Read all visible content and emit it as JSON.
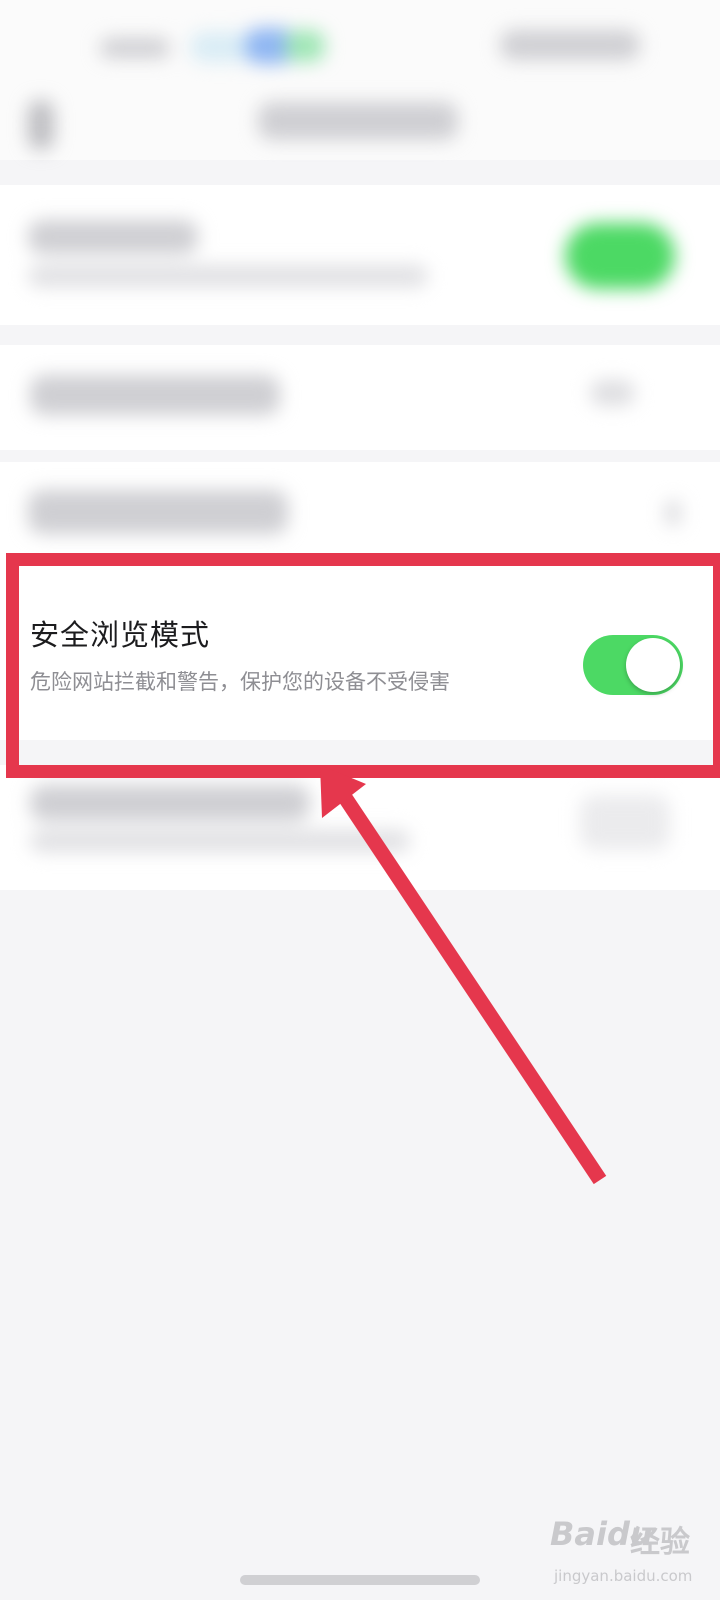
{
  "setting": {
    "title": "安全浏览模式",
    "description": "危险网站拦截和警告，保护您的设备不受侵害",
    "toggle_on": true
  },
  "watermark": {
    "logo": "Baidu",
    "jingyan": "经验",
    "url": "jingyan.baidu.com"
  },
  "colors": {
    "highlight": "#e5374d",
    "toggle_on": "#4cd964"
  }
}
